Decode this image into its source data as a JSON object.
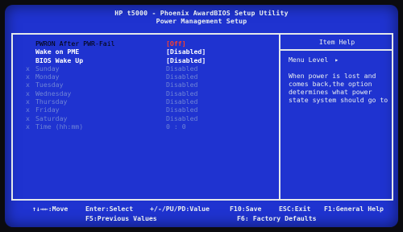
{
  "header": {
    "title_line1": "HP t5000 - Phoenix AwardBIOS Setup Utility",
    "title_line2": "Power Management Setup"
  },
  "settings": [
    {
      "label": "PWRON After PWR-Fail",
      "value": "[Off]",
      "state": "selected"
    },
    {
      "label": "Wake on PME",
      "value": "[Disabled]",
      "state": "active"
    },
    {
      "label": "BIOS Wake Up",
      "value": "[Disabled]",
      "state": "active"
    },
    {
      "marker": "x",
      "label": "Sunday",
      "value": "Disabled",
      "state": "disabled"
    },
    {
      "marker": "x",
      "label": "Monday",
      "value": "Disabled",
      "state": "disabled"
    },
    {
      "marker": "x",
      "label": "Tuesday",
      "value": "Disabled",
      "state": "disabled"
    },
    {
      "marker": "x",
      "label": "Wednesday",
      "value": "Disabled",
      "state": "disabled"
    },
    {
      "marker": "x",
      "label": "Thursday",
      "value": "Disabled",
      "state": "disabled"
    },
    {
      "marker": "x",
      "label": "Friday",
      "value": "Disabled",
      "state": "disabled"
    },
    {
      "marker": "x",
      "label": "Saturday",
      "value": "Disabled",
      "state": "disabled"
    },
    {
      "marker": "x",
      "label": "Time (hh:mm)",
      "value": "0 : 0",
      "state": "disabled"
    }
  ],
  "item_help": {
    "heading": "Item Help",
    "menu_level_label": "Menu Level",
    "menu_level_arrow": "▸",
    "text": "When power is lost and comes back,the option determines what power state system should go to"
  },
  "footer": {
    "move": "↑↓→←:Move",
    "select": "Enter:Select",
    "values": "+/-/PU/PD:Value",
    "save": "F10:Save",
    "exit": "ESC:Exit",
    "help": "F1:General Help",
    "previous": "F5:Previous Values",
    "defaults": "F6: Factory Defaults"
  },
  "colors": {
    "background": "#1f33d0",
    "text": "#e9eef0",
    "disabled_text": "#6f84d6",
    "selected_value": "#ff3f2a"
  }
}
